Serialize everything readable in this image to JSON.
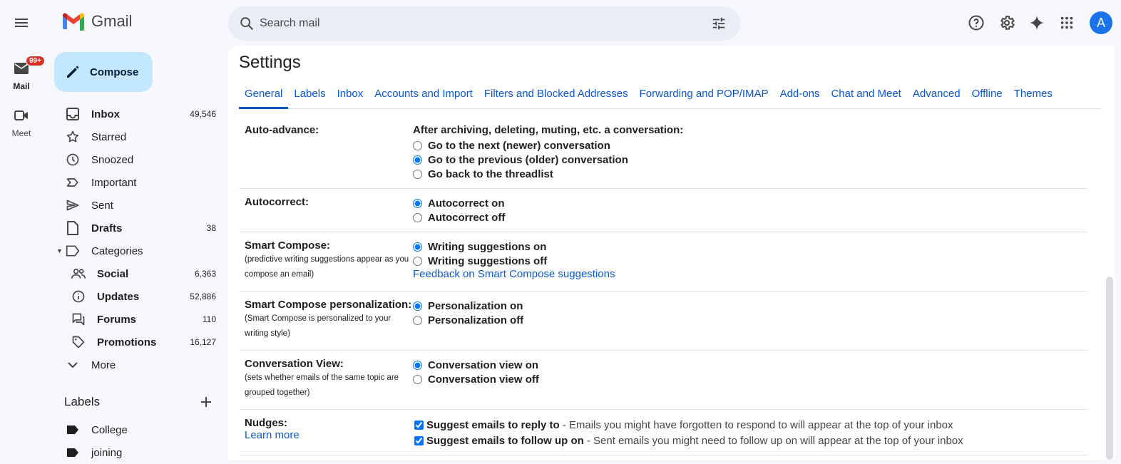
{
  "app": {
    "name": "Gmail"
  },
  "search": {
    "placeholder": "Search mail"
  },
  "avatar": {
    "initial": "A"
  },
  "rail": {
    "mail": {
      "label": "Mail",
      "badge": "99+"
    },
    "meet": {
      "label": "Meet"
    }
  },
  "compose": {
    "label": "Compose"
  },
  "nav": {
    "inbox": {
      "label": "Inbox",
      "count": "49,546"
    },
    "starred": {
      "label": "Starred"
    },
    "snoozed": {
      "label": "Snoozed"
    },
    "important": {
      "label": "Important"
    },
    "sent": {
      "label": "Sent"
    },
    "drafts": {
      "label": "Drafts",
      "count": "38"
    },
    "categories": {
      "label": "Categories"
    },
    "social": {
      "label": "Social",
      "count": "6,363"
    },
    "updates": {
      "label": "Updates",
      "count": "52,886"
    },
    "forums": {
      "label": "Forums",
      "count": "110"
    },
    "promotions": {
      "label": "Promotions",
      "count": "16,127"
    },
    "more": {
      "label": "More"
    }
  },
  "labels": {
    "heading": "Labels",
    "items": [
      "College",
      "joining"
    ]
  },
  "settings": {
    "title": "Settings",
    "tabs": [
      "General",
      "Labels",
      "Inbox",
      "Accounts and Import",
      "Filters and Blocked Addresses",
      "Forwarding and POP/IMAP",
      "Add-ons",
      "Chat and Meet",
      "Advanced",
      "Offline",
      "Themes"
    ],
    "active_tab": "General",
    "auto_advance": {
      "label": "Auto-advance:",
      "heading": "After archiving, deleting, muting, etc. a conversation:",
      "options": [
        "Go to the next (newer) conversation",
        "Go to the previous (older) conversation",
        "Go back to the threadlist"
      ],
      "selected": 1
    },
    "autocorrect": {
      "label": "Autocorrect:",
      "options": [
        "Autocorrect on",
        "Autocorrect off"
      ],
      "selected": 0
    },
    "smart_compose": {
      "label": "Smart Compose:",
      "desc": "(predictive writing suggestions appear as you compose an email)",
      "options": [
        "Writing suggestions on",
        "Writing suggestions off"
      ],
      "selected": 0,
      "feedback_link": "Feedback on Smart Compose suggestions"
    },
    "personalization": {
      "label": "Smart Compose personalization:",
      "desc": "(Smart Compose is personalized to your writing style)",
      "options": [
        "Personalization on",
        "Personalization off"
      ],
      "selected": 0
    },
    "conversation_view": {
      "label": "Conversation View:",
      "desc": "(sets whether emails of the same topic are grouped together)",
      "options": [
        "Conversation view on",
        "Conversation view off"
      ],
      "selected": 0
    },
    "nudges": {
      "label": "Nudges:",
      "learn_more": "Learn more",
      "reply": {
        "bold": "Suggest emails to reply to",
        "text": "- Emails you might have forgotten to respond to will appear at the top of your inbox",
        "checked": true
      },
      "follow_up": {
        "bold": "Suggest emails to follow up on",
        "text": "- Sent emails you might need to follow up on will appear at the top of your inbox",
        "checked": true
      }
    }
  },
  "colors": {
    "accent": "#0b57d0",
    "compose_bg": "#c2e7ff",
    "background": "#f6f8fc"
  }
}
